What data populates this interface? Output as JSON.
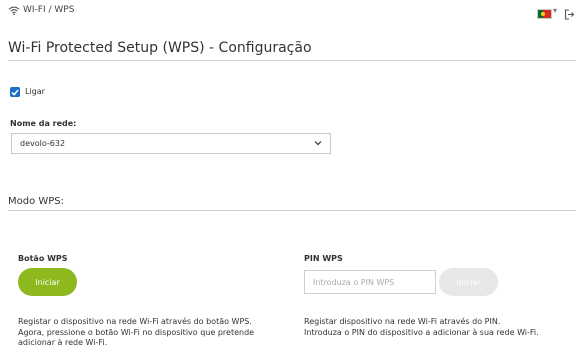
{
  "header": {
    "breadcrumb": "WI-FI / WPS",
    "wifi_icon": "wifi-icon",
    "language_flag": "portugal-flag-icon",
    "logout_icon": "logout-icon"
  },
  "page": {
    "title": "Wi-Fi Protected Setup (WPS) - Configuração"
  },
  "enable": {
    "label": "Ligar",
    "checked": true
  },
  "network": {
    "label": "Nome da rede:",
    "selected": "devolo-632"
  },
  "mode": {
    "title": "Modo WPS:"
  },
  "wps_button": {
    "label": "Botão WPS",
    "button_label": "Iniciar",
    "description_lines": [
      "Registar o dispositivo na rede Wi-Fi através do botão WPS.",
      "Agora, pressione o botão Wi-Fi no dispositivo que pretende",
      "adicionar à rede Wi-Fi."
    ]
  },
  "wps_pin": {
    "label": "PIN WPS",
    "placeholder": "Introduza o PIN WPS",
    "button_label": "Iniciar",
    "description_lines": [
      "Registar dispositivo na rede Wi-Fi através do PIN.",
      "Introduza o PIN do dispositivo a adicionar à sua rede Wi-Fi."
    ]
  },
  "colors": {
    "accent_green": "#8db81e",
    "checkbox_blue": "#1e6fc7",
    "disabled_button": "#e7e7e7",
    "flag_green": "#066a39",
    "flag_red": "#d72a23",
    "flag_crest": "#f3d11b"
  }
}
